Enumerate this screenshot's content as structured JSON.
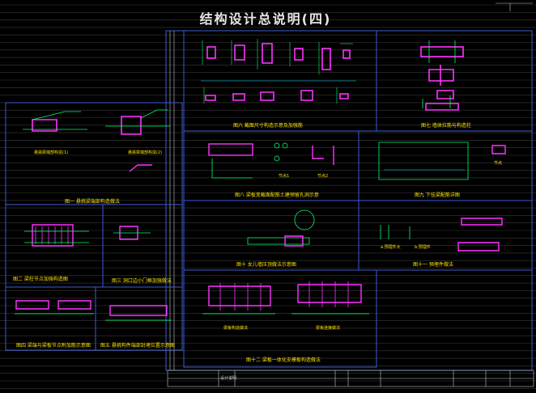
{
  "sheet": {
    "title": "结构设计总说明(四)"
  },
  "colors": {
    "background": "#000000",
    "frame": "#3b5bd6",
    "rebar": "#00ff66",
    "section": "#ff33ff",
    "dimension": "#00d9ff",
    "caption": "#ffe400",
    "title": "#e6e6e6"
  },
  "figures": {
    "fig1": {
      "caption": "图一 悬挑梁端部构造做法",
      "sub_left": "悬挑梁端部构造(1)",
      "sub_right": "悬挑梁端部构造(2)"
    },
    "fig2": {
      "caption": "图二 梁柱节点加强构造图"
    },
    "fig3": {
      "caption": "图三 洞口边小门框加强做法"
    },
    "fig4": {
      "caption": "图四 梁端与梁板节点附加筋示意图"
    },
    "fig5": {
      "caption": "图五 悬挑构件端部封堵位置示意图"
    },
    "fig6": {
      "caption": "图六 截面尺寸构造示意及加强筋"
    },
    "fig7": {
      "caption": "图七 墙体拉筋与构造柱"
    },
    "fig8": {
      "caption": "图八 梁板变截面配筋土建预留孔洞示意",
      "sub_a": "节点1",
      "sub_b": "节点2"
    },
    "fig9": {
      "caption": "图九 下挂梁配筋详图",
      "sub_a": "节点"
    },
    "fig10": {
      "caption": "图十 女儿墙压顶做法示意图"
    },
    "fig11": {
      "caption": "图十一 预埋件做法",
      "sub_a": "a.预埋件大",
      "sub_b": "b.预埋件"
    },
    "fig12": {
      "caption": "图十二 梁板一体化支模板构造做法",
      "sub_a": "梁板构造做法",
      "sub_b": "梁板连接做法"
    }
  },
  "title_block": {
    "label": "设计说明"
  }
}
